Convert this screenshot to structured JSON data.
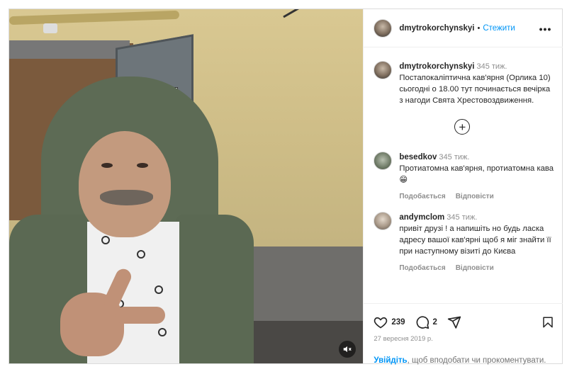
{
  "post": {
    "username": "dmytrokorchynskyi",
    "follow_label": "Стежити",
    "separator": "•",
    "more_label": "•••",
    "caption": {
      "username": "dmytrokorchynskyi",
      "time": "345 тиж.",
      "text": "Постапокаліптична кав'ярня (Орлика 10) сьогодні о 18.00 тут починається вечірка з нагоди Свята Хрестовоздвиження."
    },
    "load_more_label": "+",
    "comments": [
      {
        "username": "besedkov",
        "time": "345 тиж.",
        "text": "Протиатомна кав'ярня, протиатомна кава😁",
        "reply_label": "Подобається",
        "answer_label": "Відповісти"
      },
      {
        "username": "andymclom",
        "time": "345 тиж.",
        "text": "привіт друзі ! а напишіть но будь ласка адресу вашої кав'ярні щоб я міг знайти її при наступному візиті до Києва",
        "reply_label": "Подобається",
        "answer_label": "Відповісти"
      }
    ],
    "likes": "239",
    "comments_count": "2",
    "date": "27 вересня 2019 р.",
    "login_link": "Увійдіть",
    "login_text": ", щоб вподобати чи прокоментувати."
  },
  "icons": {
    "like": "heart-icon",
    "comment": "comment-icon",
    "share": "send-icon",
    "save": "bookmark-icon",
    "mute": "muted-speaker-icon",
    "more": "more-options-icon",
    "load_more": "plus-circle-icon"
  },
  "colors": {
    "link_blue": "#0095f6",
    "secondary_text": "#8e8e8e",
    "border": "#dbdbdb"
  }
}
